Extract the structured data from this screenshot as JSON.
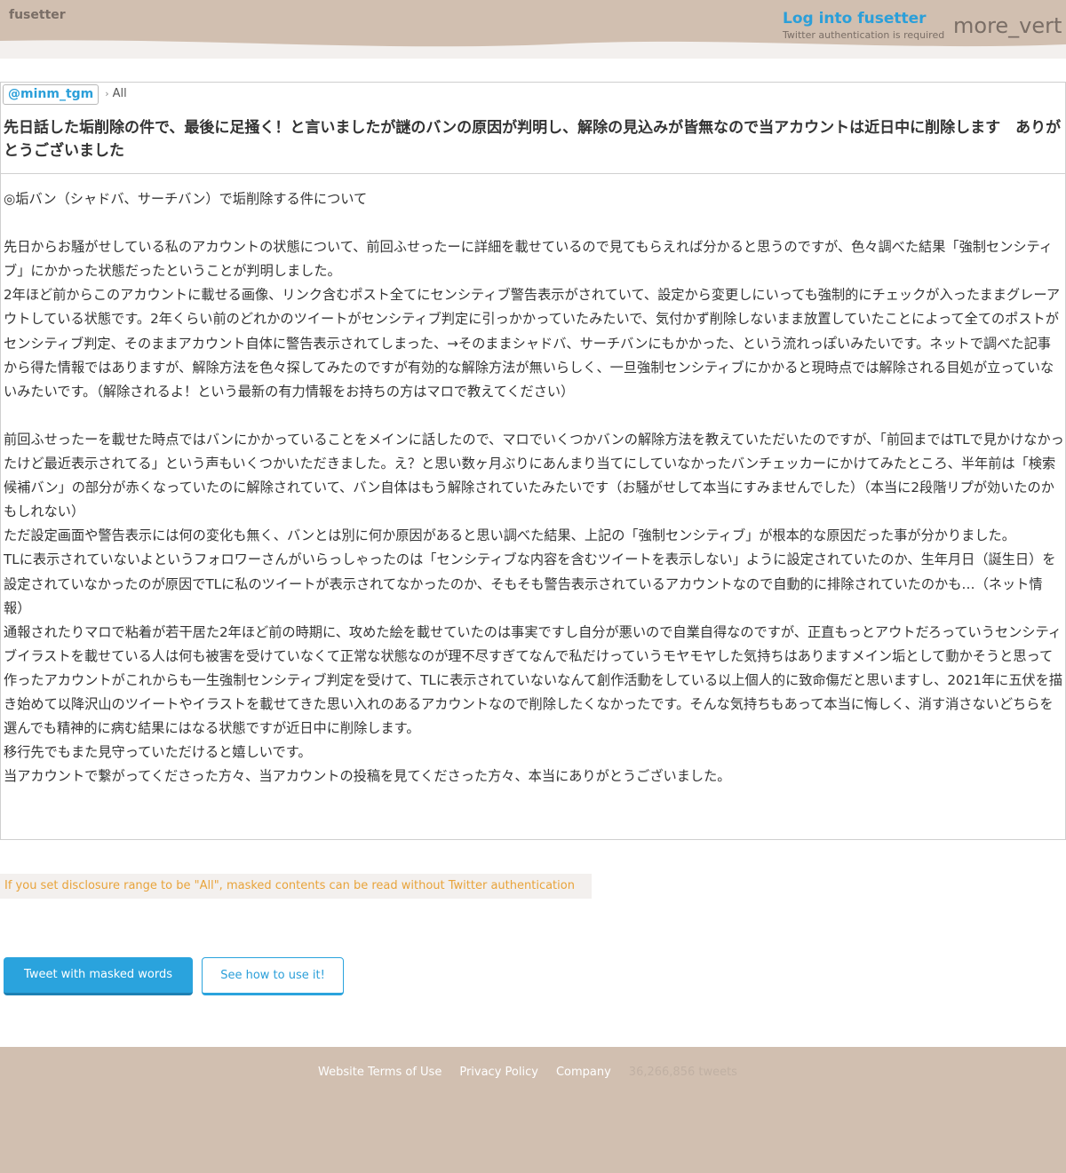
{
  "header": {
    "logo": "fusetter",
    "login_link": "Log into fusetter",
    "login_sub": "Twitter authentication is required",
    "menu_icon": "more_vert"
  },
  "colors": {
    "header_bg": "#d1bfb0",
    "accent": "#2aa3dd",
    "note_text": "#e8a33a"
  },
  "post": {
    "user": "@minm_tgm",
    "breadcrumb_sep": "›",
    "scope": "All",
    "title": "先日話した垢削除の件で、最後に足掻く！と言いましたが謎のバンの原因が判明し、解除の見込みが皆無なので当アカウントは近日中に削除します　ありがとうございました",
    "body": "◎垢バン（シャドバ、サーチバン）で垢削除する件について\n\n先日からお騒がせしている私のアカウントの状態について、前回ふせったーに詳細を載せているので見てもらえれば分かると思うのですが、色々調べた結果「強制センシティブ」にかかった状態だったということが判明しました。\n2年ほど前からこのアカウントに載せる画像、リンク含むポスト全てにセンシティブ警告表示がされていて、設定から変更しにいっても強制的にチェックが入ったままグレーアウトしている状態です。2年くらい前のどれかのツイートがセンシティブ判定に引っかかっていたみたいで、気付かず削除しないまま放置していたことによって全てのポストがセンシティブ判定、そのままアカウント自体に警告表示されてしまった、→そのままシャドバ、サーチバンにもかかった、という流れっぽいみたいです。ネットで調べた記事から得た情報ではありますが、解除方法を色々探してみたのですが有効的な解除方法が無いらしく、一旦強制センシティブにかかると現時点では解除される目処が立っていないみたいです。（解除されるよ！という最新の有力情報をお持ちの方はマロで教えてください）\n\n前回ふせったーを載せた時点ではバンにかかっていることをメインに話したので、マロでいくつかバンの解除方法を教えていただいたのですが、「前回まではTLで見かけなかったけど最近表示されてる」という声もいくつかいただきました。え？と思い数ヶ月ぶりにあんまり当てにしていなかったバンチェッカーにかけてみたところ、半年前は「検索候補バン」の部分が赤くなっていたのに解除されていて、バン自体はもう解除されていたみたいです（お騒がせして本当にすみませんでした）（本当に2段階リプが効いたのかもしれない）\nただ設定画面や警告表示には何の変化も無く、バンとは別に何か原因があると思い調べた結果、上記の「強制センシティブ」が根本的な原因だった事が分かりました。\nTLに表示されていないよというフォロワーさんがいらっしゃったのは「センシティブな内容を含むツイートを表示しない」ように設定されていたのか、生年月日（誕生日）を設定されていなかったのが原因でTLに私のツイートが表示されてなかったのか、そもそも警告表示されているアカウントなので自動的に排除されていたのかも…（ネット情報）\n通報されたりマロで粘着が若干居た2年ほど前の時期に、攻めた絵を載せていたのは事実ですし自分が悪いので自業自得なのですが、正直もっとアウトだろっていうセンシティブイラストを載せている人は何も被害を受けていなくて正常な状態なのが理不尽すぎてなんで私だけっていうモヤモヤした気持ちはありますメイン垢として動かそうと思って作ったアカウントがこれからも一生強制センシティブ判定を受けて、TLに表示されていないなんて創作活動をしている以上個人的に致命傷だと思いますし、2021年に五伏を描き始めて以降沢山のツイートやイラストを載せてきた思い入れのあるアカウントなので削除したくなかったです。そんな気持ちもあって本当に悔しく、消す消さないどちらを選んでも精神的に病む結果にはなる状態ですが近日中に削除します。\n移行先でもまた見守っていただけると嬉しいです。\n当アカウントで繋がってくださった方々、当アカウントの投稿を見てくださった方々、本当にありがとうございました。"
  },
  "note": "If you set disclosure range to be \"All\", masked contents can be read without Twitter authentication",
  "buttons": {
    "tweet": "Tweet with masked words",
    "howto": "See how to use it!"
  },
  "footer": {
    "terms": "Website Terms of Use",
    "privacy": "Privacy Policy",
    "company": "Company",
    "count": "36,266,856 tweets"
  }
}
